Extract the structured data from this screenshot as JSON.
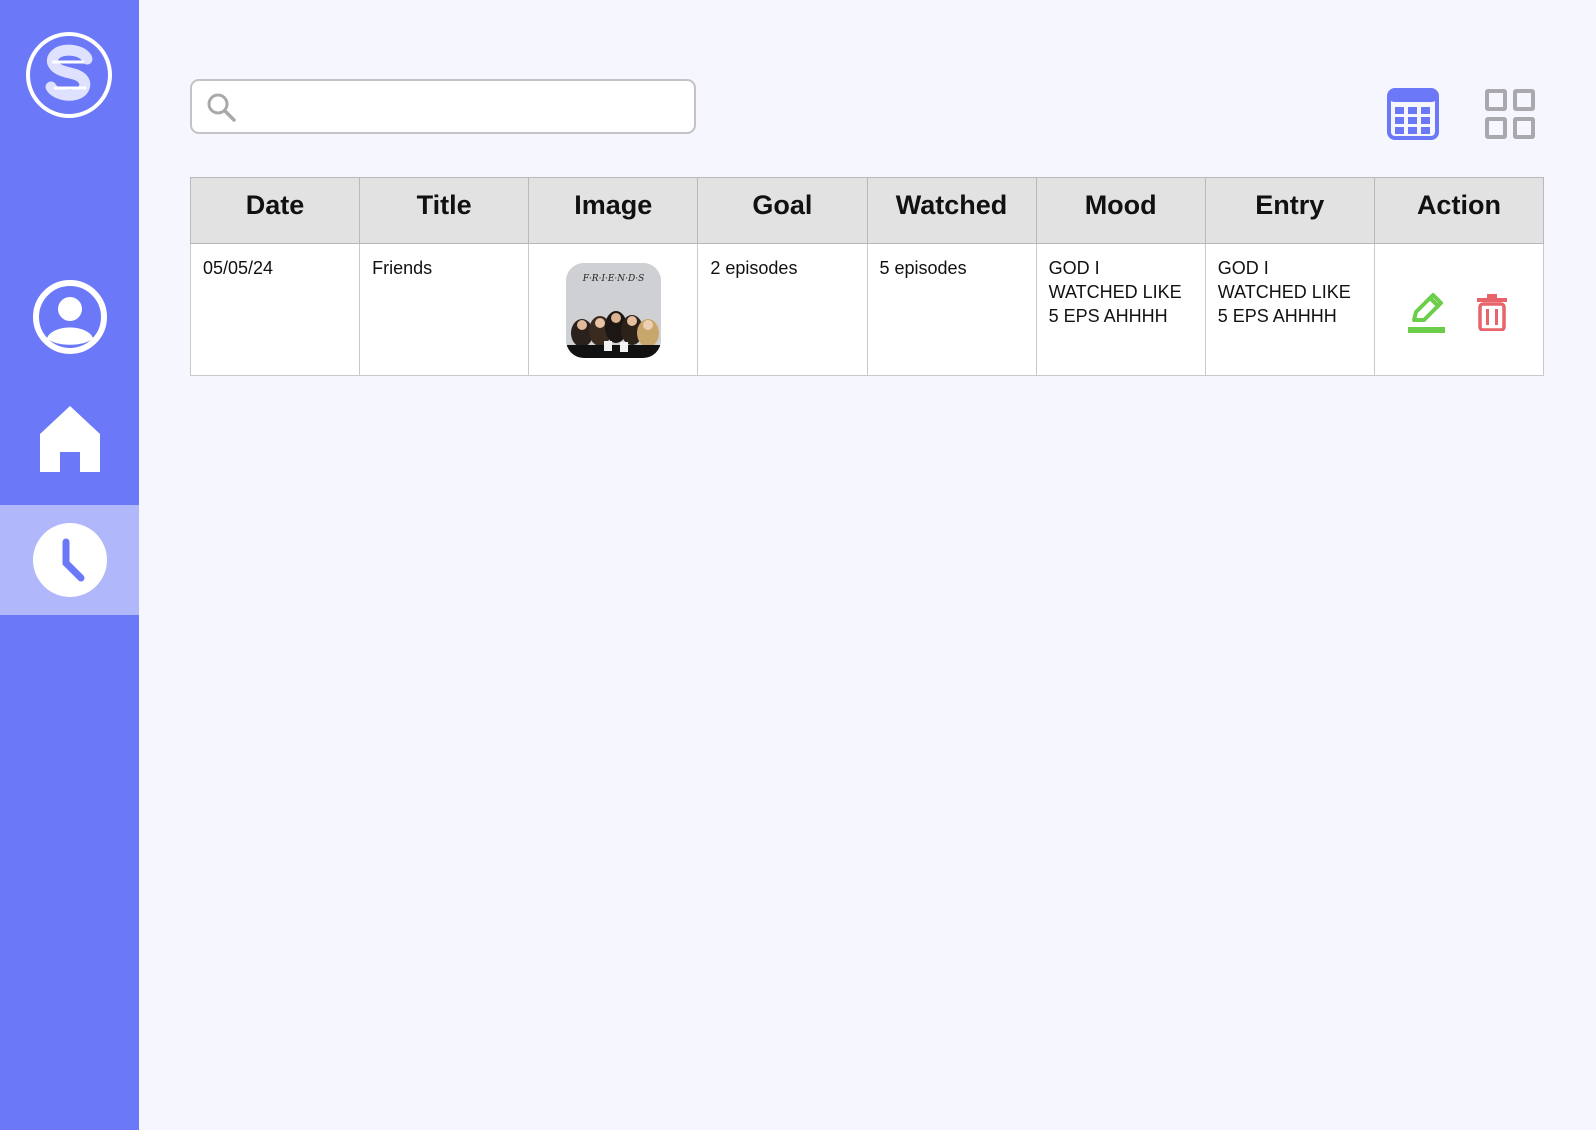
{
  "colors": {
    "sidebar": "#6b78f8",
    "sidebar_active": "#b0b8fb",
    "accent": "#6b78f8",
    "edit": "#6ccd4b",
    "delete": "#e9646a",
    "inactive_icon": "#a8a8ad"
  },
  "sidebar": {
    "logo_icon": "s-logo-icon",
    "items": [
      {
        "icon": "profile-icon",
        "active": false
      },
      {
        "icon": "home-icon",
        "active": false
      },
      {
        "icon": "history-clock-icon",
        "active": true
      }
    ]
  },
  "search": {
    "value": "",
    "placeholder": "",
    "icon": "search-icon"
  },
  "view_toggles": [
    {
      "icon": "calculator-table-icon",
      "active": true
    },
    {
      "icon": "grid-icon",
      "active": false
    }
  ],
  "table": {
    "headers": [
      "Date",
      "Title",
      "Image",
      "Goal",
      "Watched",
      "Mood",
      "Entry",
      "Action"
    ],
    "rows": [
      {
        "date": "05/05/24",
        "title": "Friends",
        "image_icon": "friends-poster-image",
        "poster_text": "F·R·I·E·N·D·S",
        "goal": "2 episodes",
        "watched": "5 episodes",
        "mood": "GOD I WATCHED LIKE 5 EPS AHHHH",
        "entry": "GOD I WATCHED LIKE 5 EPS AHHHH",
        "actions": [
          "edit-icon",
          "delete-icon"
        ]
      }
    ]
  }
}
